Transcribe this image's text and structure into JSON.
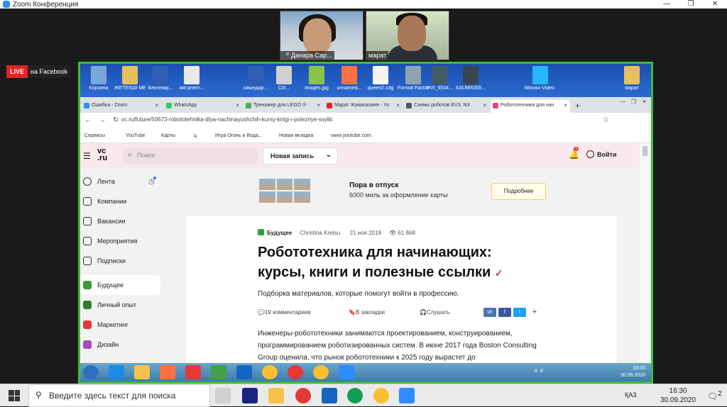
{
  "zoom": {
    "title": "Zoom Конференция",
    "participants": [
      {
        "name": "Данара Сар..."
      },
      {
        "name": "марат"
      }
    ],
    "live": {
      "badge": "LIVE",
      "target": "на Facebook"
    }
  },
  "desktop_icons": [
    {
      "label": "Корзина",
      "color": "#7aa7d8"
    },
    {
      "label": "ЖЕТЕКШІ МЕКТЕП",
      "color": "#e8c05a"
    },
    {
      "label": "Бектемір...",
      "color": "#2f5fb3"
    },
    {
      "label": "akt-priem...",
      "color": "#e9e9e9"
    },
    {
      "label": "ойындар...",
      "color": "#2f5fb3"
    },
    {
      "label": "СИ...",
      "color": "#d0d0d0"
    },
    {
      "label": "images.jpg",
      "color": "#8bc34a"
    },
    {
      "label": "unnamed...",
      "color": "#ff7043"
    },
    {
      "label": "queen2.x3g",
      "color": "#f5f5f5"
    },
    {
      "label": "Format Factory",
      "color": "#90a4ae"
    },
    {
      "label": "MVI_6504...",
      "color": "#455a64"
    },
    {
      "label": "ASUW5305...",
      "color": "#37474f"
    },
    {
      "label": "Movavi Video Edit...",
      "color": "#29b6f6"
    },
    {
      "label": "марат",
      "color": "#e8c05a"
    }
  ],
  "browser": {
    "tabs": [
      {
        "label": "Ошибка - Zoom",
        "color": "#2d8cff"
      },
      {
        "label": "WhatsApp",
        "color": "#25d366"
      },
      {
        "label": "Тренажер для LEGO ®",
        "color": "#4caf50"
      },
      {
        "label": "Марат Жумагалиев - Yo",
        "color": "#e02424"
      },
      {
        "label": "Схемы роботов EV3, NX",
        "color": "#555555"
      },
      {
        "label": "Робототехника для нач",
        "color": "#e0457b"
      }
    ],
    "url": "vc.ru/future/50673-robototehnika-dlya-nachinayushchih-kursy-knigi-i-poleznye-ssylki",
    "bookmarks": [
      "Сервисы",
      "YouTube",
      "Карты",
      "ц",
      "Игра Огонь и Вода...",
      "Новая вкладка",
      "www.youtube.com"
    ]
  },
  "vc": {
    "logo": "vc\n.ru",
    "search_placeholder": "Поиск",
    "new_post": "Новая запись",
    "notif_count": "1",
    "login": "Войти",
    "sidebar": [
      "Лента",
      "Компании",
      "Вакансии",
      "Мероприятия",
      "Подписки",
      "Будущее",
      "Личный опыт",
      "Маркетинг",
      "Дизайн"
    ],
    "ad": {
      "title": "Пора в отпуск",
      "subtitle": "6000 миль за оформление карты",
      "button": "Подробнее"
    },
    "article": {
      "section": "Будущее",
      "author": "Christina Kretsu",
      "date": "21 ноя 2018",
      "views": "61 868",
      "title": "Робототехника для начинающих: курсы, книги и полезные ссылки",
      "lead": "Подборка материалов, которые помогут войти в профессию.",
      "comments": "19 комментариев",
      "bookmarks": "В закладки",
      "listen": "Слушать",
      "body": "Инженеры-робототехники занимаются проектированием, конструированием, программированием роботизированных систем. В июне 2017 года Boston Consulting Group оценила, что рынок робототехники к 2025 году вырастет до"
    }
  },
  "inner_taskbar": {
    "tray": "КК",
    "time": "16:30",
    "date": "30.09.2020"
  },
  "taskbar": {
    "search_placeholder": "Введите здесь текст для поиска",
    "lang": "ҚАЗ",
    "time": "16:30",
    "date": "30.09.2020",
    "notif": "2"
  },
  "colors": {
    "zoom_border": "#3dbb3d",
    "vc_header": "#f9e9ec",
    "live": "#e02424"
  }
}
